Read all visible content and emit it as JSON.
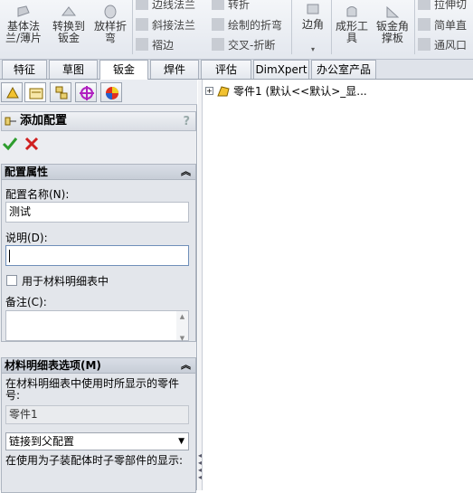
{
  "ribbon": {
    "buttons": [
      {
        "label": "基体法\n兰/薄片"
      },
      {
        "label": "转换到\n钣金"
      },
      {
        "label": "放样折\n弯"
      },
      {
        "label": "边角"
      },
      {
        "label": "成形工\n具"
      },
      {
        "label": "钣金角\n撑板"
      }
    ],
    "small_items": [
      {
        "label": "边线法兰"
      },
      {
        "label": "转折"
      },
      {
        "label": "斜接法兰"
      },
      {
        "label": "绘制的折弯"
      },
      {
        "label": "褶边"
      },
      {
        "label": "交叉-折断"
      },
      {
        "label": "拉伸切"
      },
      {
        "label": "简单直"
      },
      {
        "label": "通风口"
      }
    ]
  },
  "tabs": [
    {
      "label": "特征"
    },
    {
      "label": "草图"
    },
    {
      "label": "钣金"
    },
    {
      "label": "焊件"
    },
    {
      "label": "评估"
    },
    {
      "label": "DimXpert"
    },
    {
      "label": "办公室产品"
    }
  ],
  "panel": {
    "title": "添加配置",
    "help": "?",
    "group1": {
      "title": "配置属性",
      "name_label": "配置名称(N):",
      "name_value": "测试",
      "desc_label": "说明(D):",
      "desc_value": "",
      "bom_checkbox_label": "用于材料明细表中",
      "bom_checked": false,
      "comment_label": "备注(C):"
    },
    "group2": {
      "title": "材料明细表选项(M)",
      "desc": "在材料明细表中使用时所显示的零件号:",
      "part_number": "零件1",
      "select_value": "链接到父配置",
      "child_desc": "在使用为子装配体时子零部件的显示:"
    }
  },
  "tree": {
    "root_label": "零件1  (默认<<默认>_显...",
    "expander": "+"
  },
  "colors": {
    "accent": "#2a7fd4",
    "ok": "#2e9d2e",
    "cancel": "#d02020"
  }
}
